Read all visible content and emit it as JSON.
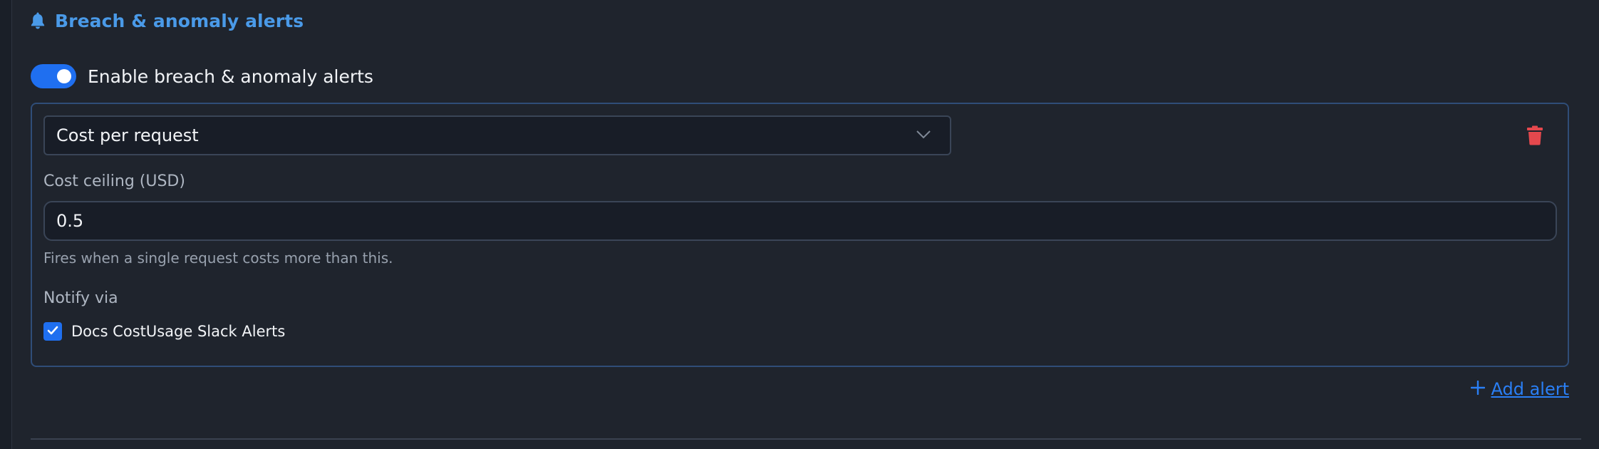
{
  "section": {
    "title": "Breach & anomaly alerts",
    "icon": "bell-icon"
  },
  "toggle": {
    "label": "Enable breach & anomaly alerts",
    "enabled": true
  },
  "alert": {
    "metric": "Cost per request",
    "field_label": "Cost ceiling (USD)",
    "field_value": "0.5",
    "helper": "Fires when a single request costs more than this.",
    "notify_label": "Notify via",
    "channels": [
      {
        "label": "Docs CostUsage Slack Alerts",
        "checked": true
      }
    ]
  },
  "actions": {
    "add_alert": "Add alert"
  },
  "colors": {
    "accent": "#1f6ff0",
    "title": "#4a9ae8",
    "danger": "#e5484d",
    "link": "#2a7ff5"
  }
}
